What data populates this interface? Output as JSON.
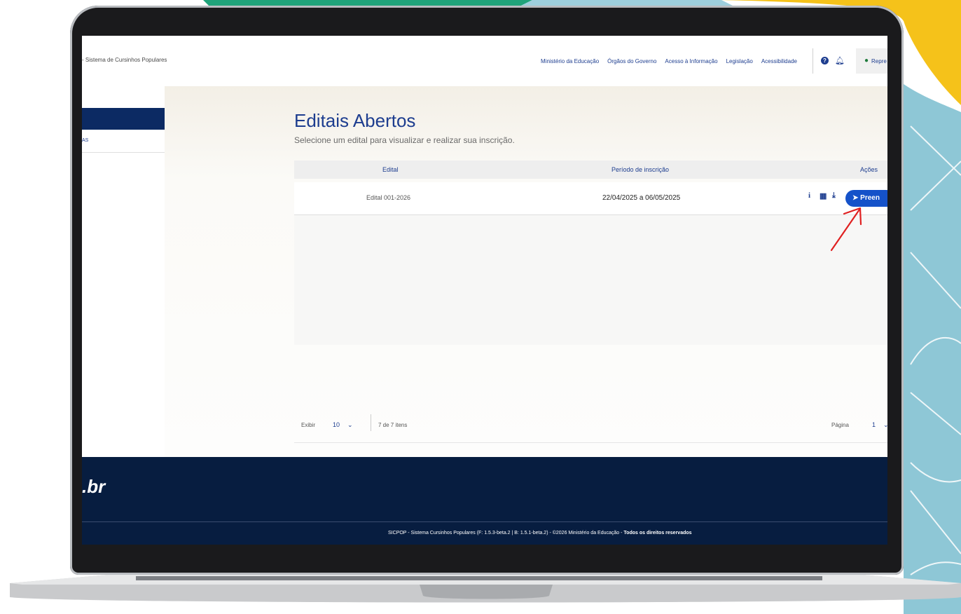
{
  "header": {
    "brand": "- Sistema de Cursinhos Populares",
    "links": [
      "Ministério da Educação",
      "Órgãos do Governo",
      "Acesso à Informação",
      "Legislação",
      "Acessibilidade"
    ],
    "help_icon": "?",
    "user_label": "Repre"
  },
  "sidebar": {
    "item_label": "AS"
  },
  "main": {
    "title": "Editais Abertos",
    "subtitle": "Selecione um edital para visualizar e realizar sua inscrição.",
    "columns": [
      "Edital",
      "Período de inscrição",
      "Ações"
    ],
    "rows": [
      {
        "edital": "Edital 001-2026",
        "periodo": "22/04/2025 a 06/05/2025",
        "action_label": "Preen"
      }
    ]
  },
  "pager": {
    "show_label": "Exibir",
    "page_size": "10",
    "count": "7 de 7 itens",
    "page_label": "Página",
    "page": "1"
  },
  "footer": {
    "logo": ".br",
    "text_main": "SICPOP - Sistema Cursinhos Populares (F: 1.5.3-beta.2 | B: 1.5.1-beta.2) - ©2026 Ministério da Educação - ",
    "text_bold": "Todos os direitos reservados"
  },
  "colors": {
    "primary": "#1d3d8f",
    "button": "#1552c9",
    "footer_bg": "#071d40",
    "arrow": "#e02020"
  },
  "icons": [
    "help-icon",
    "bell-icon",
    "user-icon",
    "info-icon",
    "pdf-icon",
    "download-icon",
    "send-icon",
    "chevron-down-icon"
  ]
}
